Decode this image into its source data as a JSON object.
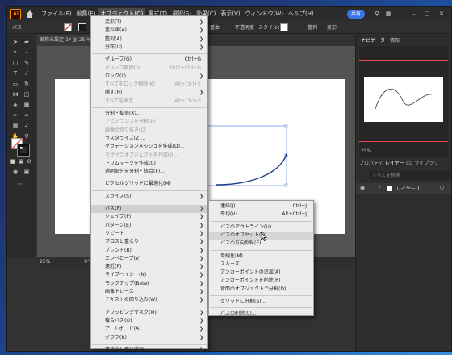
{
  "app": {
    "logo": "Ai",
    "menus": [
      "ファイル(F)",
      "編集(E)",
      "オブジェクト(O)",
      "書式(T)",
      "選択(S)",
      "効果(C)",
      "表示(V)",
      "ウィンドウ(W)",
      "ヘルプ(H)"
    ],
    "share_label": "共有"
  },
  "ctrlbar": {
    "path_label": "パス",
    "stroke_label": "基本",
    "opacity_label": "不透明度",
    "style_label": "スタイル：",
    "align_label": "整列",
    "transform_label": "変形"
  },
  "document": {
    "tab_title": "名称未設定-1* @ 25 % (RGB",
    "zoom": "25%",
    "rotation": "0°"
  },
  "panel": {
    "navigator_tab": "ナビゲーター",
    "info_tab": "情報",
    "zoom": "25%",
    "tabs": [
      "プロパティ",
      "レイヤー",
      "CC ライブラリ"
    ],
    "search_placeholder": "すべてを検索",
    "layer_name": "レイヤー 1"
  },
  "object_menu": {
    "groups": [
      [
        {
          "label": "変形(T)",
          "sub": true
        },
        {
          "label": "重ね順(A)",
          "sub": true
        },
        {
          "label": "整列(A)",
          "sub": true
        },
        {
          "label": "分布(U)",
          "sub": true
        }
      ],
      [
        {
          "label": "グループ(G)",
          "shortcut": "Ctrl+G"
        },
        {
          "label": "グループ解除(U)",
          "shortcut": "Shift+Ctrl+G",
          "disabled": true
        },
        {
          "label": "ロック(L)",
          "sub": true
        },
        {
          "label": "すべてをロック解除(K)",
          "shortcut": "Alt+Ctrl+2",
          "disabled": true
        },
        {
          "label": "隠す(H)",
          "sub": true
        },
        {
          "label": "すべてを表示",
          "shortcut": "Alt+Ctrl+3",
          "disabled": true
        }
      ],
      [
        {
          "label": "分割・拡張(X)..."
        },
        {
          "label": "アピアランスを分割(E)",
          "disabled": true
        },
        {
          "label": "画像の切り抜き(C)",
          "disabled": true
        },
        {
          "label": "ラスタライズ(Z)..."
        },
        {
          "label": "グラデーションメッシュを作成(D)..."
        },
        {
          "label": "モザイクオブジェクトを作成(J)...",
          "disabled": true
        },
        {
          "label": "トリムマークを作成(C)"
        },
        {
          "label": "透明部分を分割・統合(F)..."
        }
      ],
      [
        {
          "label": "ピクセルグリッドに最適化(M)"
        }
      ],
      [
        {
          "label": "スライス(S)",
          "sub": true
        }
      ],
      [
        {
          "label": "パス(P)",
          "sub": true,
          "highlighted": true
        },
        {
          "label": "シェイプ(P)",
          "sub": true
        },
        {
          "label": "パターン(E)",
          "sub": true
        },
        {
          "label": "リピート",
          "sub": true
        },
        {
          "label": "ブロスと重なり",
          "sub": true
        },
        {
          "label": "ブレンド(B)",
          "sub": true
        },
        {
          "label": "エンベロープ(V)",
          "sub": true
        },
        {
          "label": "遠近(P)",
          "sub": true
        },
        {
          "label": "ライブペイント(N)",
          "sub": true
        },
        {
          "label": "モックアップ(Beta)",
          "sub": true
        },
        {
          "label": "画像トレース",
          "sub": true
        },
        {
          "label": "テキストの回り込み(W)",
          "sub": true
        }
      ],
      [
        {
          "label": "クリッピングマスク(M)",
          "sub": true
        },
        {
          "label": "複合パス(O)",
          "sub": true
        },
        {
          "label": "アートボード(A)",
          "sub": true
        },
        {
          "label": "グラフ(R)",
          "sub": true
        }
      ],
      [
        {
          "label": "書き出し用に追加",
          "sub": true
        }
      ]
    ]
  },
  "path_submenu": {
    "groups": [
      [
        {
          "label": "連結(J)",
          "shortcut": "Ctrl+J"
        },
        {
          "label": "平均(V)...",
          "shortcut": "Alt+Ctrl+J"
        }
      ],
      [
        {
          "label": "パスのアウトライン(U)"
        },
        {
          "label": "パスのオフセット(O)...",
          "highlighted": true
        },
        {
          "label": "パスの方向反転(E)"
        }
      ],
      [
        {
          "label": "単純化(M)..."
        },
        {
          "label": "スムーズ..."
        },
        {
          "label": "アンカーポイントの追加(A)"
        },
        {
          "label": "アンカーポイントを削除(R)"
        },
        {
          "label": "背面のオブジェクトで分割(D)"
        }
      ],
      [
        {
          "label": "グリッドに分割(S)..."
        }
      ],
      [
        {
          "label": "パスの削除(C)..."
        }
      ]
    ]
  },
  "colors": {
    "accent": "#3a72e8",
    "curve": "#1f3a8a",
    "guide": "#e5484d"
  }
}
